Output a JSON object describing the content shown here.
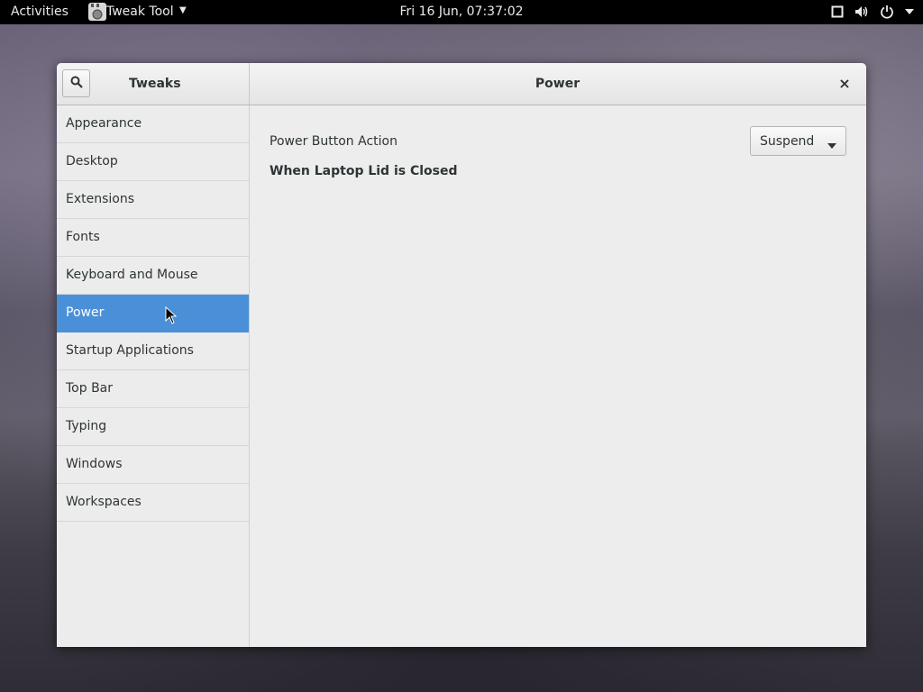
{
  "topbar": {
    "activities": "Activities",
    "app_name": "Tweak Tool",
    "clock": "Fri 16 Jun, 07:37:02",
    "tray_icons": [
      "window-icon",
      "volume-icon",
      "power-icon",
      "chevron-down-icon"
    ]
  },
  "window": {
    "sidebar_title": "Tweaks",
    "page_title": "Power",
    "close_symbol": "×",
    "sidebar": {
      "items": [
        {
          "label": "Appearance"
        },
        {
          "label": "Desktop"
        },
        {
          "label": "Extensions"
        },
        {
          "label": "Fonts"
        },
        {
          "label": "Keyboard and Mouse"
        },
        {
          "label": "Power",
          "selected": true
        },
        {
          "label": "Startup Applications"
        },
        {
          "label": "Top Bar"
        },
        {
          "label": "Typing"
        },
        {
          "label": "Windows"
        },
        {
          "label": "Workspaces"
        }
      ]
    },
    "content": {
      "power_button_action_label": "Power Button Action",
      "power_button_action_value": "Suspend",
      "laptop_lid_heading": "When Laptop Lid is Closed"
    }
  },
  "colors": {
    "accent": "#4a90d9",
    "topbar_bg": "#000000",
    "window_bg": "#ededed"
  }
}
